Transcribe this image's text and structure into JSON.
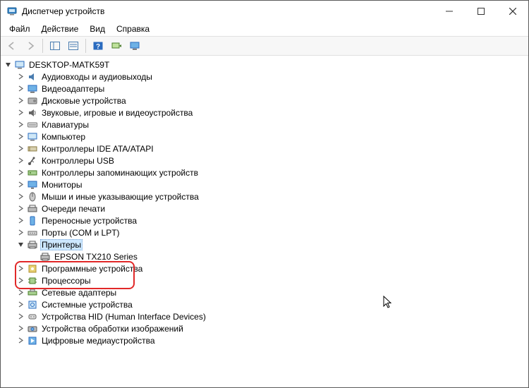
{
  "window": {
    "title": "Диспетчер устройств"
  },
  "menu": {
    "file": "Файл",
    "action": "Действие",
    "view": "Вид",
    "help": "Справка"
  },
  "toolbar": {
    "back": "back",
    "forward": "forward",
    "showhide": "show-hide-console",
    "properties": "properties",
    "help": "help",
    "refresh": "refresh",
    "monitor": "monitor"
  },
  "tree": {
    "root": "DESKTOP-MATK59T",
    "nodes": [
      {
        "label": "Аудиовходы и аудиовыходы",
        "icon": "audio"
      },
      {
        "label": "Видеоадаптеры",
        "icon": "display"
      },
      {
        "label": "Дисковые устройства",
        "icon": "disk"
      },
      {
        "label": "Звуковые, игровые и видеоустройства",
        "icon": "sound"
      },
      {
        "label": "Клавиатуры",
        "icon": "keyboard"
      },
      {
        "label": "Компьютер",
        "icon": "computer"
      },
      {
        "label": "Контроллеры IDE ATA/ATAPI",
        "icon": "ide"
      },
      {
        "label": "Контроллеры USB",
        "icon": "usb"
      },
      {
        "label": "Контроллеры запоминающих устройств",
        "icon": "storage"
      },
      {
        "label": "Мониторы",
        "icon": "monitor"
      },
      {
        "label": "Мыши и иные указывающие устройства",
        "icon": "mouse"
      },
      {
        "label": "Очереди печати",
        "icon": "printqueue"
      },
      {
        "label": "Переносные устройства",
        "icon": "portable"
      },
      {
        "label": "Порты (COM и LPT)",
        "icon": "port"
      },
      {
        "label": "Принтеры",
        "icon": "printer",
        "expanded": true,
        "selected": true,
        "children": [
          {
            "label": "EPSON TX210 Series",
            "icon": "printer"
          }
        ]
      },
      {
        "label": "Программные устройства",
        "icon": "software"
      },
      {
        "label": "Процессоры",
        "icon": "cpu"
      },
      {
        "label": "Сетевые адаптеры",
        "icon": "network"
      },
      {
        "label": "Системные устройства",
        "icon": "system"
      },
      {
        "label": "Устройства HID (Human Interface Devices)",
        "icon": "hid"
      },
      {
        "label": "Устройства обработки изображений",
        "icon": "imaging"
      },
      {
        "label": "Цифровые медиаустройства",
        "icon": "media"
      }
    ]
  }
}
